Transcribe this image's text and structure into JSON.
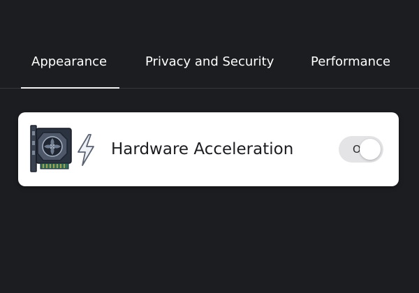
{
  "tabs": [
    {
      "label": "Appearance",
      "active": true
    },
    {
      "label": "Privacy and Security",
      "active": false
    },
    {
      "label": "Performance",
      "active": false
    }
  ],
  "setting": {
    "icon": "gpu-icon",
    "secondary_icon": "lightning-bolt-icon",
    "label": "Hardware Acceleration",
    "toggle": {
      "state": "on",
      "label": "On"
    }
  },
  "colors": {
    "background": "#1b1d20",
    "card": "#ffffff",
    "tab_text": "#ffffff",
    "active_underline": "#f2f2f2",
    "toggle_track": "#e4e4e6"
  }
}
